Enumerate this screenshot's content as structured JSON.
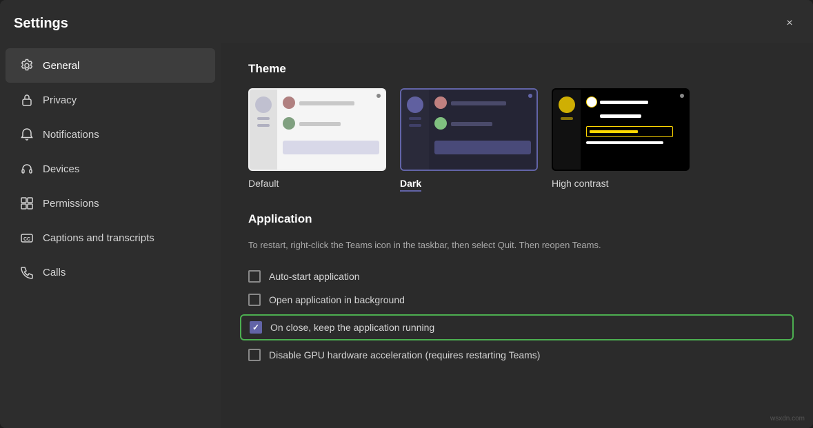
{
  "window": {
    "title": "Settings",
    "close_label": "×"
  },
  "sidebar": {
    "items": [
      {
        "id": "general",
        "label": "General",
        "icon": "gear",
        "active": true
      },
      {
        "id": "privacy",
        "label": "Privacy",
        "icon": "lock"
      },
      {
        "id": "notifications",
        "label": "Notifications",
        "icon": "bell"
      },
      {
        "id": "devices",
        "label": "Devices",
        "icon": "headset"
      },
      {
        "id": "permissions",
        "label": "Permissions",
        "icon": "grid"
      },
      {
        "id": "captions",
        "label": "Captions and transcripts",
        "icon": "cc"
      },
      {
        "id": "calls",
        "label": "Calls",
        "icon": "phone"
      }
    ]
  },
  "main": {
    "theme_section_title": "Theme",
    "themes": [
      {
        "id": "default",
        "label": "Default",
        "selected": false
      },
      {
        "id": "dark",
        "label": "Dark",
        "selected": true
      },
      {
        "id": "high_contrast",
        "label": "High contrast",
        "selected": false
      }
    ],
    "application_section_title": "Application",
    "application_description": "To restart, right-click the Teams icon in the taskbar, then select Quit. Then reopen Teams.",
    "checkboxes": [
      {
        "id": "autostart",
        "label": "Auto-start application",
        "checked": false,
        "highlighted": false
      },
      {
        "id": "background",
        "label": "Open application in background",
        "checked": false,
        "highlighted": false
      },
      {
        "id": "keep_running",
        "label": "On close, keep the application running",
        "checked": true,
        "highlighted": true
      },
      {
        "id": "disable_gpu",
        "label": "Disable GPU hardware acceleration (requires restarting Teams)",
        "checked": false,
        "highlighted": false
      }
    ]
  },
  "watermark": "wsxdn.com"
}
